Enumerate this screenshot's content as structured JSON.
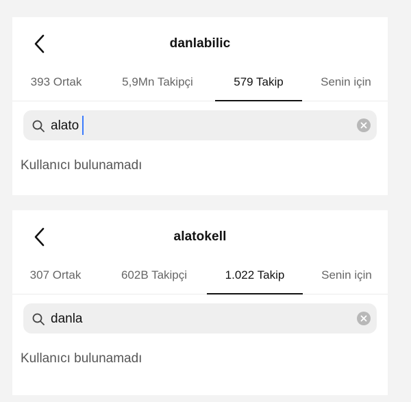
{
  "panels": [
    {
      "title": "danlabilic",
      "tabs": [
        "393 Ortak",
        "5,9Mn Takipçi",
        "579 Takip",
        "Senin için"
      ],
      "active_tab": 2,
      "search_value": "alato",
      "empty_message": "Kullanıcı bulunamadı"
    },
    {
      "title": "alatokell",
      "tabs": [
        "307 Ortak",
        "602B Takipçi",
        "1.022 Takip",
        "Senin için"
      ],
      "active_tab": 2,
      "search_value": "danla",
      "empty_message": "Kullanıcı bulunamadı"
    }
  ],
  "icons": {
    "back": "chevron-left-icon",
    "search": "search-icon",
    "clear": "clear-icon"
  },
  "colors": {
    "caret": "#3a7bfd",
    "active_tab_underline": "#111111",
    "search_bg": "#efefef"
  }
}
